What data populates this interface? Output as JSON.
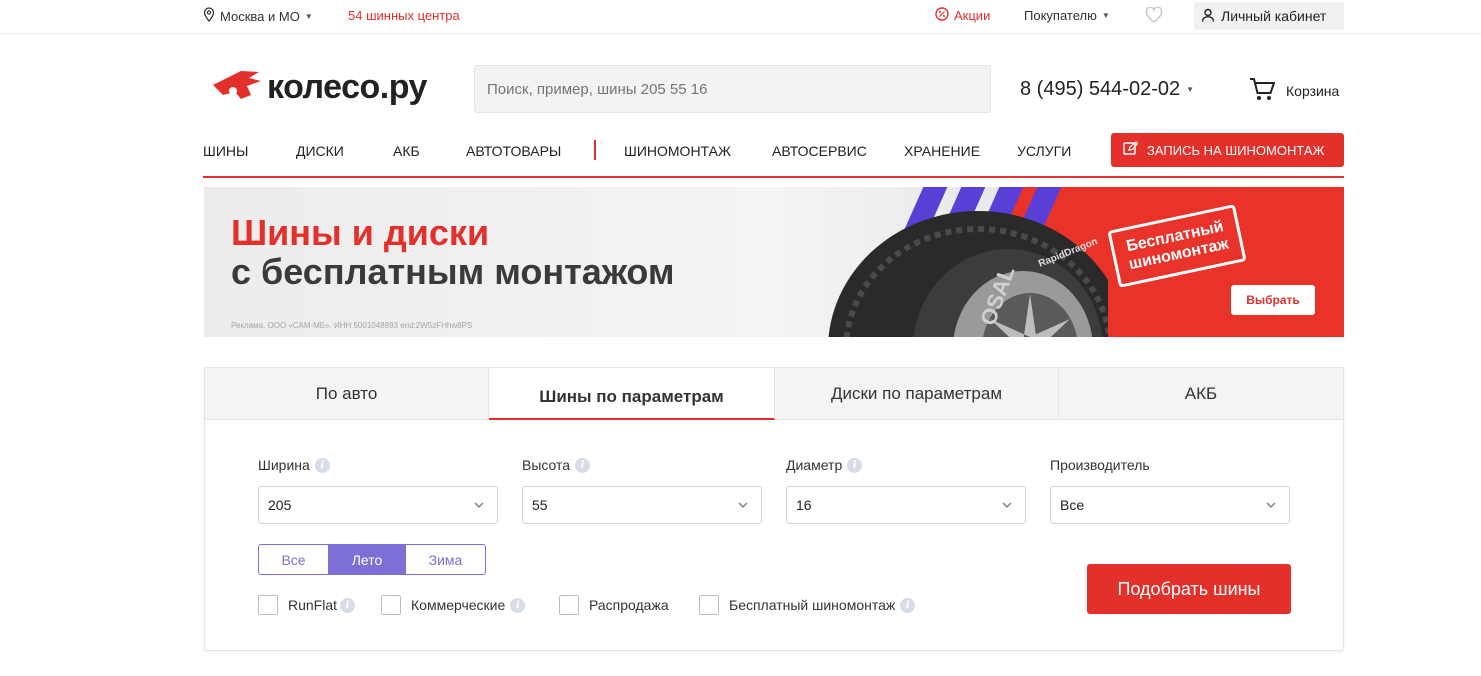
{
  "topbar": {
    "location": "Москва и МО",
    "centers": "54 шинных центра",
    "promo": "Акции",
    "buyer": "Покупателю",
    "cabinet": "Личный кабинет"
  },
  "header": {
    "logo_text": "колесо.ру",
    "search_placeholder": "Поиск, пример, шины 205 55 16",
    "phone": "8 (495) 544-02-02",
    "cart": "Корзина"
  },
  "nav": {
    "items": [
      "Шины",
      "Диски",
      "АКБ",
      "Автотовары",
      "Шиномонтаж",
      "Автосервис",
      "Хранение",
      "Услуги"
    ],
    "cta": "Запись на шиномонтаж"
  },
  "banner": {
    "line1": "Шины и диски",
    "line2": "с бесплатным монтажом",
    "legal": "Реклама. ООО «САМ-МБ». ИНН 5001048893 erid:2W5zFHhw8PS",
    "stamp": "Бесплатный шиномонтаж",
    "tyre_brand": "RapidDragon",
    "tyre_sidewall": "OSAL",
    "button": "Выбрать"
  },
  "filter": {
    "tabs": [
      "По авто",
      "Шины по параметрам",
      "Диски по параметрам",
      "АКБ"
    ],
    "active_tab": "Шины по параметрам",
    "fields": [
      {
        "label": "Ширина",
        "value": "205",
        "info": true
      },
      {
        "label": "Высота",
        "value": "55",
        "info": true
      },
      {
        "label": "Диаметр",
        "value": "16",
        "info": true
      },
      {
        "label": "Производитель",
        "value": "Все",
        "info": false
      }
    ],
    "season": [
      "Все",
      "Лето",
      "Зима"
    ],
    "season_selected": "Лето",
    "checkboxes": [
      {
        "label": "RunFlat",
        "checked": false,
        "info": true
      },
      {
        "label": "Коммерческие",
        "checked": false,
        "info": true
      },
      {
        "label": "Распродажа",
        "checked": false,
        "info": false
      },
      {
        "label": "Бесплатный шиномонтаж",
        "checked": false,
        "info": true
      }
    ],
    "submit": "Подобрать шины"
  },
  "colors": {
    "brand_red": "#e4302b",
    "season_accent": "#7c6fd6",
    "banner_purple": "#5a3fd6"
  }
}
